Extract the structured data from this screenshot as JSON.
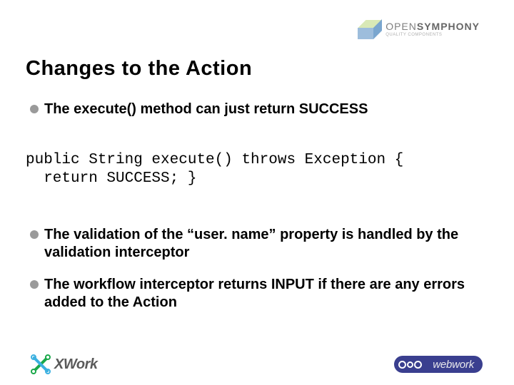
{
  "header": {
    "logo": {
      "name_light": "OPEN",
      "name_bold": "SYMPHONY",
      "tagline": "QUALITY COMPONENTS"
    }
  },
  "title": "Changes to the Action",
  "bullets": [
    "The execute() method can just return SUCCESS",
    "The validation of the “user. name” property is handled by the validation interceptor",
    "The workflow interceptor returns INPUT if there are any errors added to the Action"
  ],
  "code": "public String execute() throws Exception {\n  return SUCCESS; }",
  "footer": {
    "left": "XWork",
    "right": "webwork"
  }
}
